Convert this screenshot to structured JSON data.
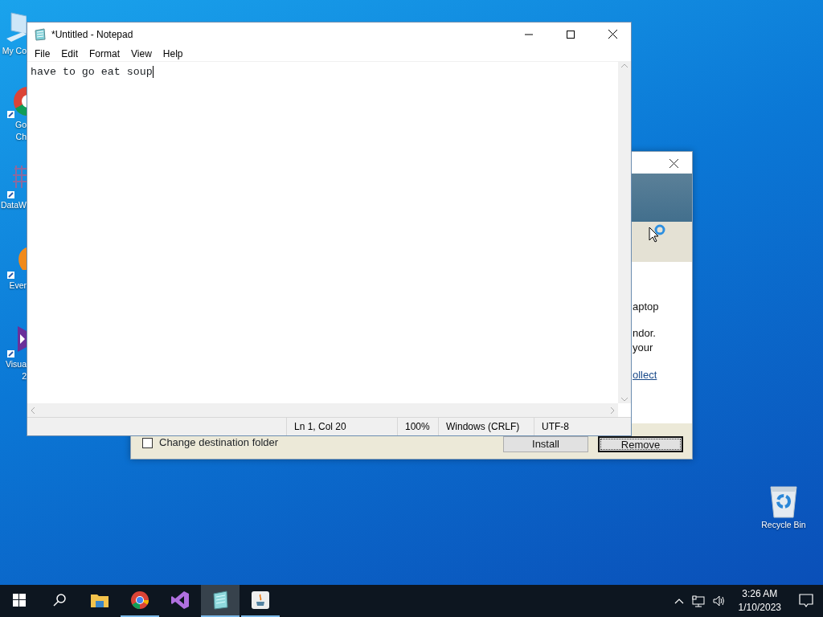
{
  "desktop_icons": [
    {
      "kind": "computer",
      "label": "My Co"
    },
    {
      "kind": "chrome",
      "label": "Go\nCh"
    },
    {
      "kind": "grid",
      "label": "DataW"
    },
    {
      "kind": "leaf",
      "label": "Ever"
    },
    {
      "kind": "vs",
      "label": "Visua\n2"
    }
  ],
  "recycle_bin": {
    "label": "Recycle Bin"
  },
  "installer_window": {
    "text_fragments": [
      "aptop",
      "ndor.",
      "your"
    ],
    "link": "ollect",
    "checkbox": {
      "label": "Change destination folder",
      "checked": false
    },
    "buttons": [
      {
        "label": "Install",
        "focused": false
      },
      {
        "label": "Remove",
        "focused": true
      }
    ]
  },
  "notepad": {
    "title": "*Untitled - Notepad",
    "menu": [
      "File",
      "Edit",
      "Format",
      "View",
      "Help"
    ],
    "text": "have to go eat soup",
    "status": [
      "Ln 1, Col 20",
      "100%",
      "Windows (CRLF)",
      "UTF-8"
    ]
  },
  "taskbar": {
    "apps": [
      {
        "kind": "start",
        "running": false,
        "active": false
      },
      {
        "kind": "search",
        "running": false,
        "active": false
      },
      {
        "kind": "explorer",
        "running": false,
        "active": false
      },
      {
        "kind": "chrome",
        "running": true,
        "active": false
      },
      {
        "kind": "vs",
        "running": false,
        "active": false
      },
      {
        "kind": "notepad",
        "running": true,
        "active": true
      },
      {
        "kind": "java",
        "running": true,
        "active": false
      }
    ],
    "clock": {
      "time": "3:26 AM",
      "date": "1/10/2023"
    }
  }
}
